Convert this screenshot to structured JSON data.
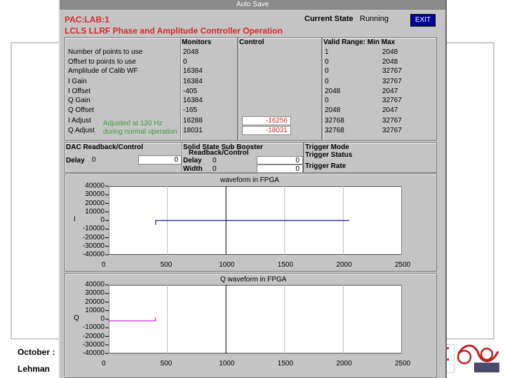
{
  "footer": {
    "date": "October :",
    "author": "Lehman"
  },
  "window": {
    "title": "Auto Save",
    "pv_name": "PAC:LAB:1",
    "subtitle": "LCLS LLRF Phase and Amplitude Controller Operation",
    "current_state_label": "Current State",
    "current_state_value": "Running",
    "exit_label": "EXIT"
  },
  "params": {
    "col_monitors": "Monitors",
    "col_control": "Control",
    "col_valid": "Valid Range: Min Max",
    "rows": [
      {
        "label": "Number of points to use",
        "monitor": "2048",
        "control": "",
        "min": "1",
        "max": "2048"
      },
      {
        "label": "Offset to points to use",
        "monitor": "0",
        "control": "",
        "min": "0",
        "max": "2048"
      },
      {
        "label": "Amplitude of Calib WF",
        "monitor": "16384",
        "control": "",
        "min": "0",
        "max": "32767"
      },
      {
        "label": "I Gain",
        "monitor": "16384",
        "control": "",
        "min": "0",
        "max": "32767"
      },
      {
        "label": "I Offset",
        "monitor": "-405",
        "control": "",
        "min": "2048",
        "max": "2047"
      },
      {
        "label": "Q Gain",
        "monitor": "16384",
        "control": "",
        "min": "0",
        "max": "32767"
      },
      {
        "label": "Q Offset",
        "monitor": "-165",
        "control": "",
        "min": "2048",
        "max": "2047"
      },
      {
        "label": "I Adjust",
        "monitor": "16288",
        "control": "-16256",
        "min": "32768",
        "max": "32767"
      },
      {
        "label": "Q Adjust",
        "monitor": "18031",
        "control": "-18031",
        "min": "32768",
        "max": "32767"
      }
    ],
    "annot_1": "Adjusted at 120 Hz",
    "annot_2": "during normal operation"
  },
  "dac": {
    "title": "DAC Readback/Control",
    "delay_label": "Delay",
    "delay_value": "0",
    "delay_control": "0"
  },
  "booster": {
    "title": "Solid State Sub Booster",
    "subtitle": "Readback/Control",
    "delay_label": "Delay",
    "delay_value": "0",
    "width_label": "Width",
    "width_value": "0",
    "delay_control": "0",
    "width_control": "0"
  },
  "trigger": {
    "mode": "Trigger Mode",
    "status": "Trigger Status",
    "rate": "Trigger Rate"
  },
  "chart_data": [
    {
      "type": "line",
      "title": "waveform in FPGA",
      "ylabel": "I",
      "x_ticks": [
        "0",
        "500",
        "1000",
        "1500",
        "2000",
        "2500"
      ],
      "y_ticks": [
        "40000",
        "30000",
        "20000",
        "10000",
        "0",
        "-10000",
        "-20000",
        "-30000",
        "-40000"
      ],
      "xlim": [
        0,
        2500
      ],
      "ylim": [
        -40000,
        40000
      ],
      "series": [
        {
          "color": "#1a1a8c",
          "points": [
            [
              400,
              -5000
            ],
            [
              400,
              0
            ],
            [
              2050,
              0
            ]
          ]
        }
      ]
    },
    {
      "type": "line",
      "title": "Q waveform in FPGA",
      "ylabel": "Q",
      "x_ticks": [
        "0",
        "500",
        "1000",
        "1500",
        "2000",
        "2500"
      ],
      "y_ticks": [
        "40000",
        "30000",
        "20000",
        "10000",
        "0",
        "-10000",
        "-20000",
        "-30000",
        "-40000"
      ],
      "xlim": [
        0,
        2500
      ],
      "ylim": [
        -40000,
        40000
      ],
      "series": [
        {
          "color": "#c020c0",
          "points": [
            [
              0,
              -2000
            ],
            [
              400,
              -2000
            ],
            [
              400,
              2000
            ]
          ]
        }
      ]
    }
  ]
}
